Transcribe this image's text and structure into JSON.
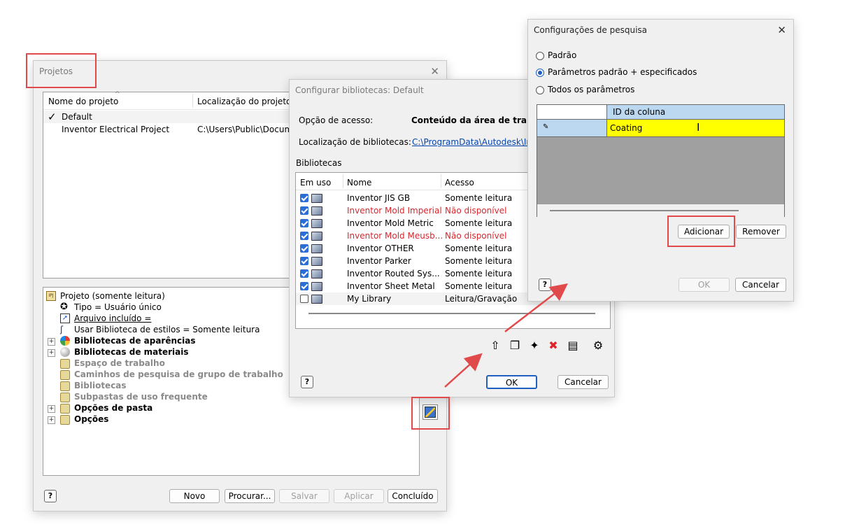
{
  "projetos": {
    "title": "Projetos",
    "col_nome": "Nome do projeto",
    "col_loc": "Localização do projeto",
    "rows": [
      {
        "check": "✓",
        "name": "Default",
        "loc": ""
      },
      {
        "check": "",
        "name": "Inventor Electrical Project",
        "loc": "C:\\Users\\Public\\Documen"
      }
    ],
    "tree": [
      {
        "label": "Projeto (somente leitura)"
      },
      {
        "label": "Tipo = Usuário único"
      },
      {
        "label": "Arquivo incluído ="
      },
      {
        "label": "Usar Biblioteca de estilos = Somente leitura"
      },
      {
        "label": "Bibliotecas de aparências"
      },
      {
        "label": "Bibliotecas de materiais"
      },
      {
        "label": "Espaço de trabalho"
      },
      {
        "label": "Caminhos de pesquisa de grupo de trabalho"
      },
      {
        "label": "Bibliotecas"
      },
      {
        "label": "Subpastas de uso frequente"
      },
      {
        "label": "Opções de pasta"
      },
      {
        "label": "Opções"
      }
    ],
    "buttons": {
      "novo": "Novo",
      "procurar": "Procurar...",
      "salvar": "Salvar",
      "aplicar": "Aplicar",
      "concluido": "Concluído"
    }
  },
  "config_bib": {
    "title": "Configurar bibliotecas: Default",
    "opcao_label": "Opção de acesso:",
    "opcao_value": "Conteúdo da área de trabal",
    "loc_label": "Localização de bibliotecas:",
    "loc_value": "C:\\ProgramData\\Autodesk\\Inv",
    "group_label": "Bibliotecas",
    "col_uso": "Em uso",
    "col_nome": "Nome",
    "col_acesso": "Acesso",
    "rows": [
      {
        "checked": true,
        "name": "Inventor JIS GB",
        "access": "Somente leitura",
        "red": false
      },
      {
        "checked": true,
        "name": "Inventor Mold Imperial",
        "access": "Não disponível",
        "red": true
      },
      {
        "checked": true,
        "name": "Inventor Mold Metric",
        "access": "Somente leitura",
        "red": false
      },
      {
        "checked": true,
        "name": "Inventor Mold Meusb...",
        "access": "Não disponível",
        "red": true
      },
      {
        "checked": true,
        "name": "Inventor OTHER",
        "access": "Somente leitura",
        "red": false
      },
      {
        "checked": true,
        "name": "Inventor Parker",
        "access": "Somente leitura",
        "red": false
      },
      {
        "checked": true,
        "name": "Inventor Routed Sys...",
        "access": "Somente leitura",
        "red": false
      },
      {
        "checked": true,
        "name": "Inventor Sheet Metal",
        "access": "Somente leitura",
        "red": false
      },
      {
        "checked": false,
        "name": "My Library",
        "access": "Leitura/Gravação",
        "red": false
      }
    ],
    "ok": "OK",
    "cancelar": "Cancelar"
  },
  "config_pesq": {
    "title": "Configurações de pesquisa",
    "options": [
      "Padrão",
      "Parâmetros padrão + especificados",
      "Todos os parâmetros"
    ],
    "selected": 1,
    "col_header": "ID da coluna",
    "value": "Coating",
    "adicionar": "Adicionar",
    "remover": "Remover",
    "ok": "OK",
    "cancelar": "Cancelar"
  },
  "colors": {
    "highlight": "#e04a4a",
    "selection": "#ffff00",
    "link": "#0645ad",
    "unavailable": "#d9262c"
  }
}
